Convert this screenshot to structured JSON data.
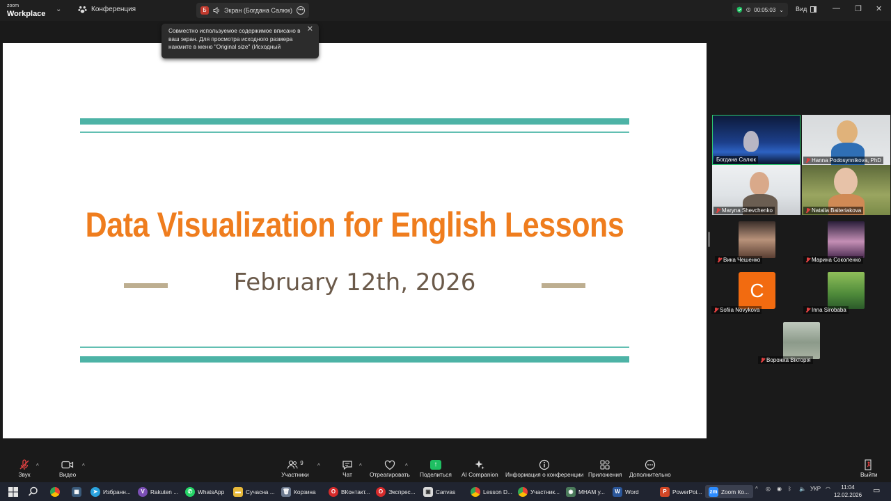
{
  "topbar": {
    "brand_line1": "zoom",
    "brand_line2": "Workplace",
    "meeting_label": "Конференция",
    "share_badge": "Б",
    "share_label": "Экран (Богдана Салюк)",
    "timer": "00:05:03",
    "view_label": "Вид"
  },
  "tooltip": {
    "text": "Совместно используемое содержимое вписано в ваш экран. Для просмотра исходного размера нажмите в меню \"Original size\" (Исходный"
  },
  "slide": {
    "title": "Data Visualization for English Lessons",
    "date": "February 12th, 2026",
    "colors": {
      "teal": "#4db3a6",
      "orange": "#ef7d1e",
      "tan": "#bdae90",
      "date_text": "#6b5a4a"
    }
  },
  "participants": {
    "tiles": [
      {
        "name": "Богдана Салюк",
        "muted": false,
        "active": true
      },
      {
        "name": "Hanna Podosynnikova, PhD",
        "muted": true
      },
      {
        "name": "Maryna Shevchenko",
        "muted": true
      },
      {
        "name": "Natalia Baiteriakova",
        "muted": true
      }
    ],
    "small": [
      {
        "name": "Вика Чешенко",
        "muted": true
      },
      {
        "name": "Марина Соколенко",
        "muted": true
      },
      {
        "name": "Sofiia Novykova",
        "muted": true,
        "avatar_letter": "C"
      },
      {
        "name": "Inna Sirobaba",
        "muted": true
      },
      {
        "name": "Ворожка Вікторія",
        "muted": true
      }
    ]
  },
  "toolbar": {
    "sound": "Звук",
    "video": "Видео",
    "participants": "Участники",
    "participants_count": "9",
    "chat": "Чат",
    "react": "Отреагировать",
    "share": "Поделиться",
    "ai": "AI Companion",
    "info": "Информация о конференции",
    "apps": "Приложения",
    "more": "Дополнительно",
    "leave": "Выйти"
  },
  "taskbar": {
    "items": [
      "Избранн...",
      "Rakuten ...",
      "WhatsApp",
      "Сучасна ...",
      "Корзина",
      "ВКонтакт...",
      "Экспрес...",
      "Canvas",
      "Lesson D...",
      "Участник...",
      "МНАМ у...",
      "Word",
      "PowerPoi...",
      "Zoom Ко..."
    ],
    "lang": "УКР",
    "time": "11:04",
    "date": "12.02.2026"
  }
}
